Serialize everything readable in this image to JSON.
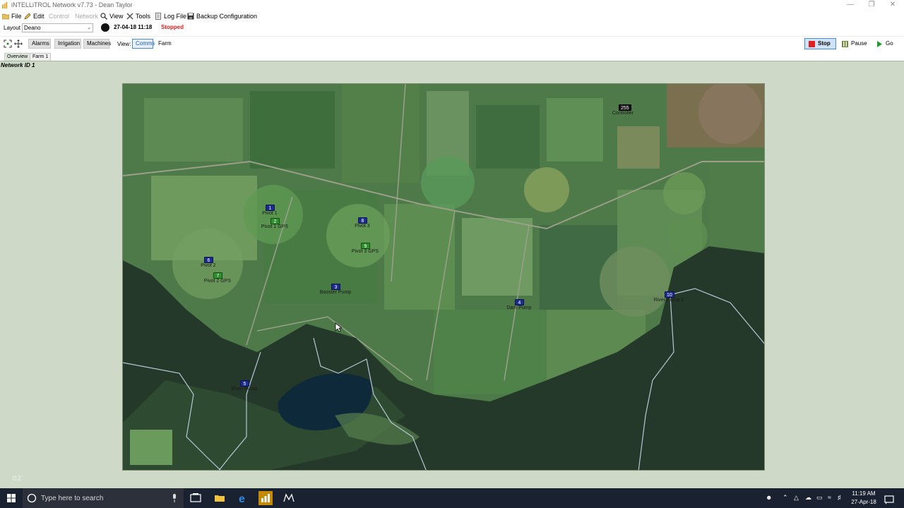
{
  "window": {
    "title": "iNTELLiTROL Network v7.73 - Dean Taylor"
  },
  "menu": {
    "file": "File",
    "edit": "Edit",
    "control": "Control",
    "network": "Network",
    "view": "View",
    "tools": "Tools",
    "log_file": "Log File",
    "backup": "Backup Configuration"
  },
  "layout_bar": {
    "label": "Layout",
    "selected": "Deano",
    "datetime": "27-04-18 11:18",
    "status": "Stopped",
    "status_color": "#d81f1f"
  },
  "toolbar": {
    "alarms": "Alarms",
    "irrigation": "Irrigation",
    "machines": "Machines",
    "view_label": "View:",
    "comms": "Comms",
    "farm": "Farm",
    "stop": "Stop",
    "pause": "Pause",
    "go": "Go"
  },
  "tabs": {
    "overview": "Overview",
    "farm1": "Farm 1"
  },
  "network_label": "Network ID 1",
  "nodes": [
    {
      "id": "1",
      "label": "Pivot 1",
      "color": "blue"
    },
    {
      "id": "2",
      "label": "Pivot 1 GPS",
      "color": "green"
    },
    {
      "id": "8",
      "label": "Pivot 3",
      "color": "blue"
    },
    {
      "id": "9",
      "label": "Pivot 3 GPS",
      "color": "green"
    },
    {
      "id": "6",
      "label": "Pivot 2",
      "color": "blue"
    },
    {
      "id": "7",
      "label": "Pivot 2 GPS",
      "color": "green"
    },
    {
      "id": "3",
      "label": "Booster Pump",
      "color": "blue"
    },
    {
      "id": "4",
      "label": "Dam Pump",
      "color": "blue"
    },
    {
      "id": "10",
      "label": "River Pump 2",
      "color": "blue"
    },
    {
      "id": "5",
      "label": "River Pump",
      "color": "blue"
    },
    {
      "id": "255",
      "label": "Controller",
      "color": "black"
    }
  ],
  "taskbar": {
    "search_placeholder": "Type here to search",
    "time": "11:19 AM",
    "date": "27-Apr-18"
  },
  "watermark": "ez"
}
